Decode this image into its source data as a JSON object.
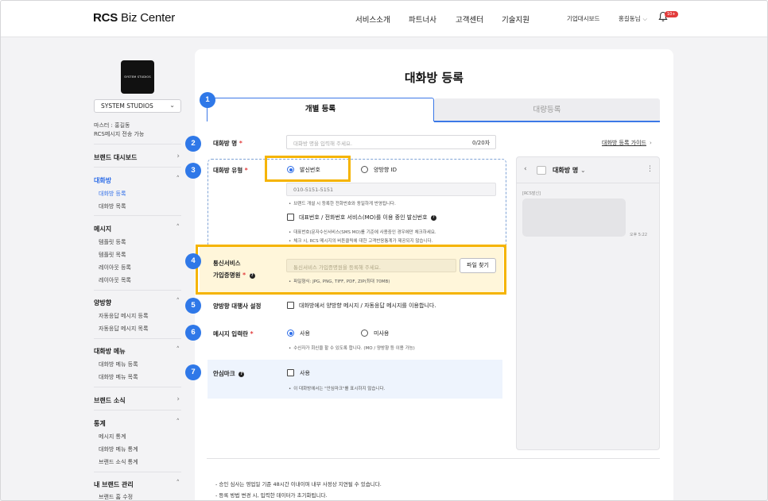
{
  "header": {
    "logo_bold": "RCS",
    "logo_rest": "Biz Center",
    "nav": [
      "서비스소개",
      "파트너사",
      "고객센터",
      "기술지원"
    ],
    "util_dashboard": "기업대시보드",
    "user": "홍길동님",
    "notification_count": "10+"
  },
  "sidebar": {
    "brand_logo_text": "SYSTEM STUDIOS",
    "brand_select": "SYSTEM STUDIOS",
    "info_master": "마스터 : 홍길동",
    "info_rcs": "RCS메시지 전송 가능",
    "groups": [
      {
        "label": "브랜드 대시보드",
        "subs": []
      },
      {
        "label": "대화방",
        "subs": [
          "대화방 등록",
          "대화방 목록"
        ]
      },
      {
        "label": "메시지",
        "subs": [
          "템플릿 등록",
          "템플릿 목록",
          "레이아웃 등록",
          "레이아웃 목록"
        ]
      },
      {
        "label": "양방향",
        "subs": [
          "자동응답 메시지 등록",
          "자동응답 메시지 목록"
        ]
      },
      {
        "label": "대화방 메뉴",
        "subs": [
          "대화방 메뉴 등록",
          "대화방 메뉴 목록"
        ]
      },
      {
        "label": "브랜드 소식",
        "subs": []
      },
      {
        "label": "통계",
        "subs": [
          "메시지 통계",
          "대화방 메뉴 통계",
          "브랜드 소식 통계"
        ]
      },
      {
        "label": "내 브랜드 관리",
        "subs": [
          "브랜드 홈 수정"
        ]
      }
    ],
    "active_group": "대화방",
    "active_sub": "대화방 등록"
  },
  "main": {
    "title": "대화방 등록",
    "tabs": [
      "개별 등록",
      "대량등록"
    ],
    "active_tab": "개별 등록",
    "steps": [
      "1",
      "2",
      "3",
      "4",
      "5",
      "6",
      "7"
    ],
    "name_field": {
      "label": "대화방 명",
      "placeholder": "대화방 명을 입력해 주세요.",
      "counter": "0/20자"
    },
    "guide_link": "대화방 등록 가이드",
    "type_field": {
      "label": "대화방 유형",
      "option_sender": "발신번호",
      "option_bidirectional": "양방향 ID",
      "selected": "발신번호",
      "sender_number": "010-5151-5151",
      "note1": "브랜드 개설 시 등록한 전화번호와 동일하게 반영됩니다.",
      "checkbox_label": "대표번호 / 전화번호 서비스(MO)를 이용 중인 발신번호",
      "note2": "대표번호(문자수신서비스(SMS MO)를 기준에 사용중인 경우에만 체크하세요.",
      "note3": "체크 시, RCS 메시지의 버튼클릭에 대한 고객반응통계가 제공되지 않습니다."
    },
    "cert_field": {
      "label_line1": "통신서비스",
      "label_line2": "가입증명원",
      "placeholder": "통신서비스 가입증명원을 등록해 주세요.",
      "button": "파일 찾기",
      "note": "파일형식: JPG, PNG, TIFF, PDF, ZIP(최대 70MB)"
    },
    "agency_field": {
      "label": "양방향 대행사 설정",
      "checkbox_label": "대화방에서 양방향 메시지 / 자동응답 메시지를 이용합니다."
    },
    "input_field": {
      "label": "메시지 입력란",
      "option_use": "사용",
      "option_unused": "미사용",
      "selected": "사용",
      "note": "수신자가 회신을 할 수 있도록 합니다. (MO / 양방향 등 이용 가능)"
    },
    "safe_mark": {
      "label": "안심마크",
      "checkbox_label": "사용",
      "note": "이 대화방에서는 \"안심마크\"를 표시하지 않습니다."
    },
    "footer_notes": [
      "- 승인 심사는 영업일 기준 48시간 이내이며 내부 사정상 지연될 수 있습니다.",
      "- 등록 방법 변경 시, 입력한 데이터가 초기화됩니다."
    ]
  },
  "preview": {
    "title": "대화방 명",
    "tag": "[RCS발신]",
    "time": "오후 5:22"
  },
  "colors": {
    "accent": "#2f78e8",
    "highlight": "#f5b400",
    "required": "#e23b3b"
  }
}
